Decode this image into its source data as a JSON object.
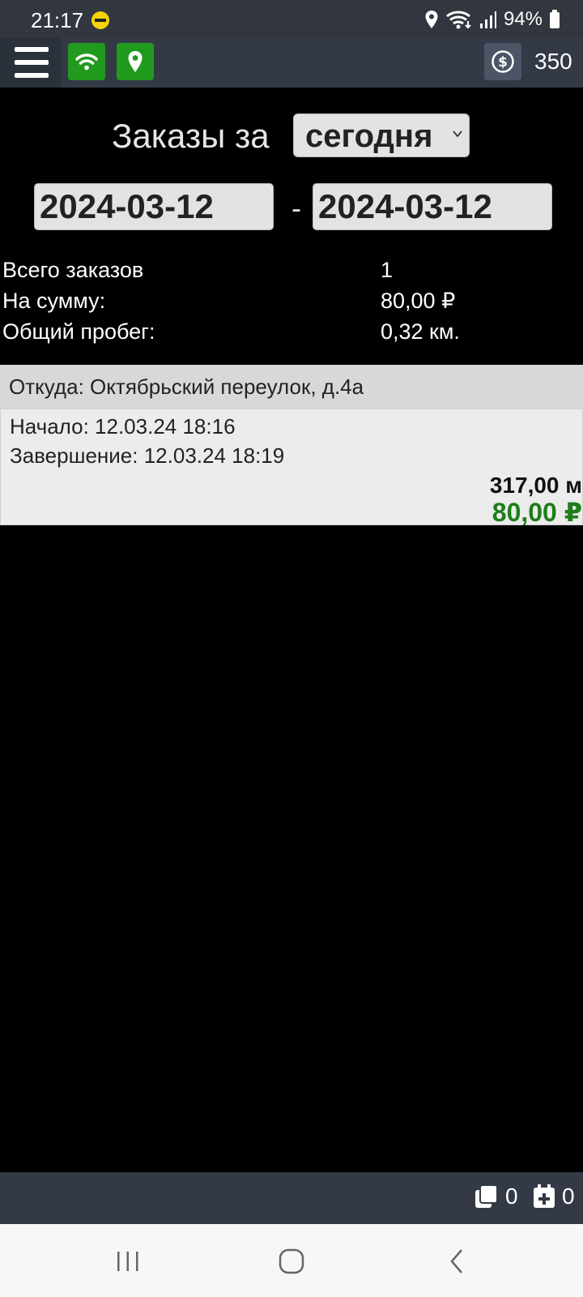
{
  "status_bar": {
    "time": "21:17",
    "battery": "94%",
    "icons": [
      "location-icon",
      "wifi-icon",
      "signal-icon",
      "battery-icon"
    ]
  },
  "toolbar": {
    "balance": "350",
    "wifi_status_color": "#219a1d",
    "gps_status_color": "#219a1d"
  },
  "filter": {
    "label": "Заказы за",
    "period": "сегодня",
    "date_from": "2024-03-12",
    "date_separator": "-",
    "date_to": "2024-03-12"
  },
  "summary": {
    "rows": [
      {
        "label": "Всего заказов",
        "value": "1"
      },
      {
        "label": "На сумму:",
        "value": "80,00 ₽"
      },
      {
        "label": "Общий пробег:",
        "value": "0,32 км."
      }
    ]
  },
  "orders": [
    {
      "from": "Откуда: Октябрьский переулок, д.4а",
      "start": "Начало: 12.03.24 18:16",
      "end": "Завершение: 12.03.24 18:19",
      "distance": "317,00 м",
      "price": "80,00 ₽"
    }
  ],
  "bottom_bar": {
    "orders_count": "0",
    "scheduled_count": "0"
  },
  "colors": {
    "accent_green": "#219a1d",
    "price_green": "#1e7e1a",
    "bar_bg": "#333a46"
  }
}
